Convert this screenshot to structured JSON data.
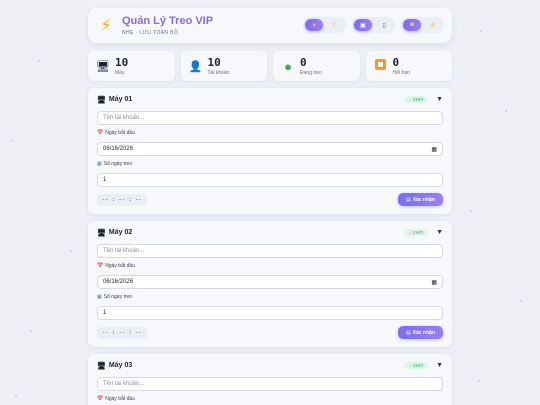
{
  "header": {
    "logo_icon": "bolt-icon",
    "title": "Quản Lý Treo VIP",
    "subtitle": "NHẸ · LƯU TOÀN BỘ",
    "toggle_groups": [
      {
        "name": "theme",
        "options": [
          {
            "icon": "sun-icon",
            "glyph": "☀",
            "active": true
          },
          {
            "icon": "moon-icon",
            "glyph": "☾",
            "active": false
          }
        ]
      },
      {
        "name": "view",
        "options": [
          {
            "icon": "desktop-icon",
            "glyph": "▣",
            "active": true
          },
          {
            "icon": "mobile-icon",
            "glyph": "▯",
            "active": false
          }
        ]
      },
      {
        "name": "mode",
        "options": [
          {
            "icon": "sound-icon",
            "glyph": "♪",
            "active": true
          },
          {
            "icon": "warning-icon",
            "glyph": "⚠",
            "active": false
          }
        ]
      }
    ]
  },
  "stats": [
    {
      "icon": "computer-icon",
      "glyph": "🖥",
      "value": "10",
      "label": "Máy"
    },
    {
      "icon": "user-icon",
      "glyph": "👤",
      "value": "10",
      "label": "Tài khoản"
    },
    {
      "icon": "green-dot-icon",
      "glyph": "●",
      "value": "0",
      "label": "Đang treo"
    },
    {
      "icon": "stop-icon",
      "glyph": "■",
      "value": "0",
      "label": "Hết hạn"
    }
  ],
  "labels": {
    "start_date": "Ngày bắt đầu",
    "days": "Số ngày treo",
    "confirm": "Xác nhận",
    "account_placeholder": "Tên tài khoản..."
  },
  "machines": [
    {
      "name": "Máy 01",
      "status": "CHỜ",
      "account": "",
      "start_date": "06/16/2026",
      "days": "1",
      "timer": "-- : -- : --"
    },
    {
      "name": "Máy 02",
      "status": "CHỜ",
      "account": "",
      "start_date": "06/16/2026",
      "days": "1",
      "timer": "-- : -- : --"
    },
    {
      "name": "Máy 03",
      "status": "CHỜ",
      "account": "",
      "start_date": "",
      "days": "",
      "timer": ""
    }
  ],
  "colors": {
    "accent": "#8b6ae6",
    "status_wait": "#2f9a6a",
    "bolt": "#f2b31a"
  }
}
